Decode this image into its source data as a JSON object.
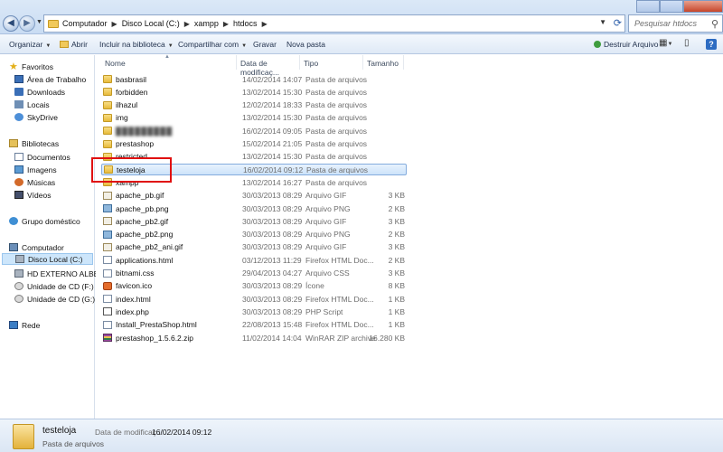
{
  "address": {
    "crumbs": [
      "Computador",
      "Disco Local (C:)",
      "xampp",
      "htdocs"
    ],
    "search_placeholder": "Pesquisar htdocs"
  },
  "toolbar": {
    "organize": "Organizar",
    "open": "Abrir",
    "include": "Incluir na biblioteca",
    "share": "Compartilhar com",
    "burn": "Gravar",
    "new_folder": "Nova pasta",
    "destroy": "Destruir Arquivo"
  },
  "sidebar": {
    "favorites": "Favoritos",
    "fav_items": [
      "Área de Trabalho",
      "Downloads",
      "Locais",
      "SkyDrive"
    ],
    "libraries": "Bibliotecas",
    "lib_items": [
      "Documentos",
      "Imagens",
      "Músicas",
      "Vídeos"
    ],
    "homegroup": "Grupo doméstico",
    "computer": "Computador",
    "comp_items": [
      "Disco Local (C:)",
      "HD EXTERNO ALBERTO",
      "Unidade de CD (F:)",
      "Unidade de CD (G:)"
    ],
    "network": "Rede"
  },
  "columns": {
    "name": "Nome",
    "date": "Data de modificaç...",
    "type": "Tipo",
    "size": "Tamanho"
  },
  "files": [
    {
      "name": "basbrasil",
      "date": "14/02/2014 14:07",
      "type": "Pasta de arquivos",
      "size": "",
      "icon": "folder"
    },
    {
      "name": "forbidden",
      "date": "13/02/2014 15:30",
      "type": "Pasta de arquivos",
      "size": "",
      "icon": "folder"
    },
    {
      "name": "ilhazul",
      "date": "12/02/2014 18:33",
      "type": "Pasta de arquivos",
      "size": "",
      "icon": "folder"
    },
    {
      "name": "img",
      "date": "13/02/2014 15:30",
      "type": "Pasta de arquivos",
      "size": "",
      "icon": "folder"
    },
    {
      "name": "",
      "date": "16/02/2014 09:05",
      "type": "Pasta de arquivos",
      "size": "",
      "icon": "folder"
    },
    {
      "name": "prestashop",
      "date": "15/02/2014 21:05",
      "type": "Pasta de arquivos",
      "size": "",
      "icon": "folder"
    },
    {
      "name": "restricted",
      "date": "13/02/2014 15:30",
      "type": "Pasta de arquivos",
      "size": "",
      "icon": "folder"
    },
    {
      "name": "testeloja",
      "date": "16/02/2014 09:12",
      "type": "Pasta de arquivos",
      "size": "",
      "icon": "folder"
    },
    {
      "name": "xampp",
      "date": "13/02/2014 16:27",
      "type": "Pasta de arquivos",
      "size": "",
      "icon": "folder"
    },
    {
      "name": "apache_pb.gif",
      "date": "30/03/2013 08:29",
      "type": "Arquivo GIF",
      "size": "3 KB",
      "icon": "gif"
    },
    {
      "name": "apache_pb.png",
      "date": "30/03/2013 08:29",
      "type": "Arquivo PNG",
      "size": "2 KB",
      "icon": "png"
    },
    {
      "name": "apache_pb2.gif",
      "date": "30/03/2013 08:29",
      "type": "Arquivo GIF",
      "size": "3 KB",
      "icon": "gif"
    },
    {
      "name": "apache_pb2.png",
      "date": "30/03/2013 08:29",
      "type": "Arquivo PNG",
      "size": "2 KB",
      "icon": "png"
    },
    {
      "name": "apache_pb2_ani.gif",
      "date": "30/03/2013 08:29",
      "type": "Arquivo GIF",
      "size": "3 KB",
      "icon": "gif"
    },
    {
      "name": "applications.html",
      "date": "03/12/2013 11:29",
      "type": "Firefox HTML Doc...",
      "size": "2 KB",
      "icon": "html"
    },
    {
      "name": "bitnami.css",
      "date": "29/04/2013 04:27",
      "type": "Arquivo CSS",
      "size": "3 KB",
      "icon": "css"
    },
    {
      "name": "favicon.ico",
      "date": "30/03/2013 08:29",
      "type": "Ícone",
      "size": "8 KB",
      "icon": "ico"
    },
    {
      "name": "index.html",
      "date": "30/03/2013 08:29",
      "type": "Firefox HTML Doc...",
      "size": "1 KB",
      "icon": "html"
    },
    {
      "name": "index.php",
      "date": "30/03/2013 08:29",
      "type": "PHP Script",
      "size": "1 KB",
      "icon": "php"
    },
    {
      "name": "Install_PrestaShop.html",
      "date": "22/08/2013 15:48",
      "type": "Firefox HTML Doc...",
      "size": "1 KB",
      "icon": "html"
    },
    {
      "name": "prestashop_1.5.6.2.zip",
      "date": "11/02/2014 14:04",
      "type": "WinRAR ZIP archive",
      "size": "16.280 KB",
      "icon": "zip"
    }
  ],
  "selected_index": 7,
  "details": {
    "name": "testeloja",
    "type": "Pasta de arquivos",
    "modified_label": "Data de modificaç...",
    "modified_value": "16/02/2014 09:12"
  }
}
